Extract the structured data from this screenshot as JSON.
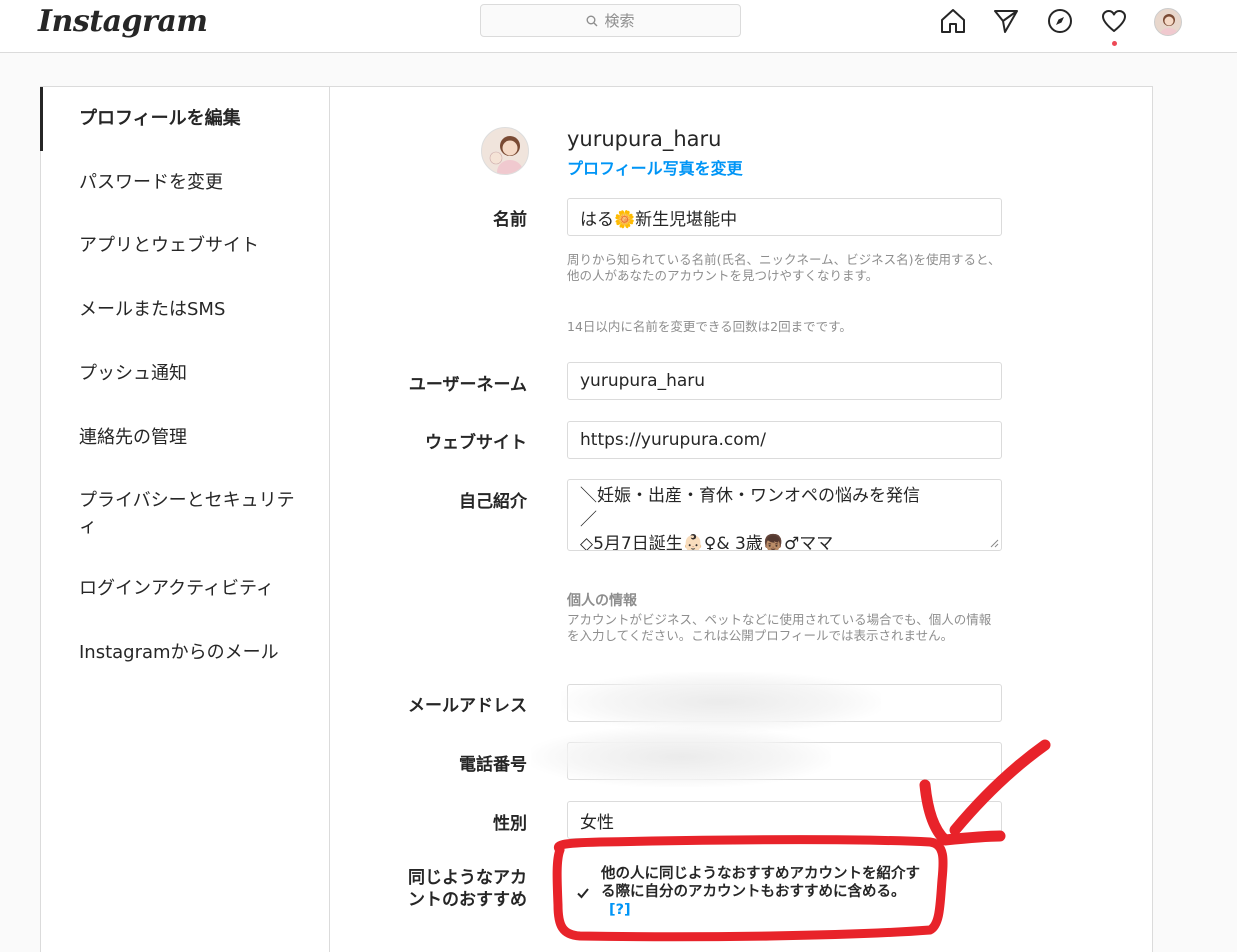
{
  "nav": {
    "logo": "Instagram",
    "search_placeholder": "検索"
  },
  "sidebar": {
    "items": [
      {
        "label": "プロフィールを編集"
      },
      {
        "label": "パスワードを変更"
      },
      {
        "label": "アプリとウェブサイト"
      },
      {
        "label": "メールまたはSMS"
      },
      {
        "label": "プッシュ通知"
      },
      {
        "label": "連絡先の管理"
      },
      {
        "label": "プライバシーとセキュリティ"
      },
      {
        "label": "ログインアクティビティ"
      },
      {
        "label": "Instagramからのメール"
      }
    ]
  },
  "profile": {
    "username": "yurupura_haru",
    "change_photo": "プロフィール写真を変更"
  },
  "form": {
    "name_label": "名前",
    "name_value": "はる🌼新生児堪能中",
    "name_help": "周りから知られている名前(氏名、ニックネーム、ビジネス名)を使用すると、他の人があなたのアカウントを見つけやすくなります。",
    "name_limit": "14日以内に名前を変更できる回数は2回までです。",
    "username_label": "ユーザーネーム",
    "username_value": "yurupura_haru",
    "website_label": "ウェブサイト",
    "website_value": "https://yurupura.com/",
    "bio_label": "自己紹介",
    "bio_line1": "＼妊娠・出産・育休・ワンオペの悩みを発信",
    "bio_line2": "／",
    "bio_line3": "◇5月7日誕生👶🏻♀& 3歳👦🏽♂ママ",
    "personal_title": "個人の情報",
    "personal_help": "アカウントがビジネス、ペットなどに使用されている場合でも、個人の情報を入力してください。これは公開プロフィールでは表示されません。",
    "email_label": "メールアドレス",
    "phone_label": "電話番号",
    "gender_label": "性別",
    "gender_value": "女性",
    "similar_label_1": "同じようなアカ",
    "similar_label_2": "ントのおすすめ",
    "similar_text": "他の人に同じようなおすすめアカウントを紹介する際に自分のアカウントもおすすめに含める。",
    "similar_help": "[?]"
  },
  "colors": {
    "link": "#0095f6",
    "annotation": "#e8232a"
  }
}
